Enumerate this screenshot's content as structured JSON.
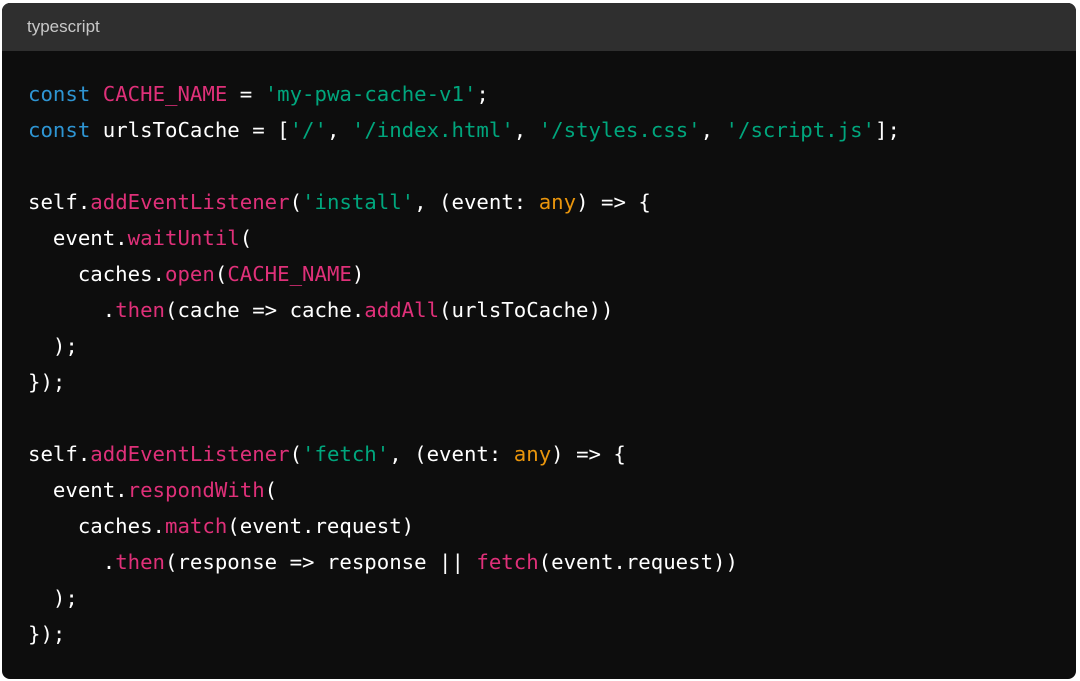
{
  "header": {
    "language": "typescript"
  },
  "colors": {
    "keyword": "#2e95d3",
    "identifier": "#df3079",
    "string": "#00a67d",
    "type": "#e9950c",
    "plain": "#ffffff",
    "background": "#0d0d0d",
    "header": "#2f2f2f"
  },
  "code": [
    [
      [
        "const",
        "kw"
      ],
      [
        " ",
        "pl"
      ],
      [
        "CACHE_NAME",
        "red"
      ],
      [
        " = ",
        "pl"
      ],
      [
        "'my-pwa-cache-v1'",
        "str"
      ],
      [
        ";",
        "pl"
      ]
    ],
    [
      [
        "const",
        "kw"
      ],
      [
        " urlsToCache = [",
        "pl"
      ],
      [
        "'/'",
        "str"
      ],
      [
        ", ",
        "pl"
      ],
      [
        "'/index.html'",
        "str"
      ],
      [
        ", ",
        "pl"
      ],
      [
        "'/styles.css'",
        "str"
      ],
      [
        ", ",
        "pl"
      ],
      [
        "'/script.js'",
        "str"
      ],
      [
        "];",
        "pl"
      ]
    ],
    [],
    [
      [
        "self.",
        "pl"
      ],
      [
        "addEventListener",
        "red"
      ],
      [
        "(",
        "pl"
      ],
      [
        "'install'",
        "str"
      ],
      [
        ", (event: ",
        "pl"
      ],
      [
        "any",
        "typ"
      ],
      [
        ") => {",
        "pl"
      ]
    ],
    [
      [
        "  event.",
        "pl"
      ],
      [
        "waitUntil",
        "red"
      ],
      [
        "(",
        "pl"
      ]
    ],
    [
      [
        "    caches.",
        "pl"
      ],
      [
        "open",
        "red"
      ],
      [
        "(",
        "pl"
      ],
      [
        "CACHE_NAME",
        "red"
      ],
      [
        ")",
        "pl"
      ]
    ],
    [
      [
        "      .",
        "pl"
      ],
      [
        "then",
        "red"
      ],
      [
        "(cache => cache.",
        "pl"
      ],
      [
        "addAll",
        "red"
      ],
      [
        "(urlsToCache))",
        "pl"
      ]
    ],
    [
      [
        "  );",
        "pl"
      ]
    ],
    [
      [
        "});",
        "pl"
      ]
    ],
    [],
    [
      [
        "self.",
        "pl"
      ],
      [
        "addEventListener",
        "red"
      ],
      [
        "(",
        "pl"
      ],
      [
        "'fetch'",
        "str"
      ],
      [
        ", (event: ",
        "pl"
      ],
      [
        "any",
        "typ"
      ],
      [
        ") => {",
        "pl"
      ]
    ],
    [
      [
        "  event.",
        "pl"
      ],
      [
        "respondWith",
        "red"
      ],
      [
        "(",
        "pl"
      ]
    ],
    [
      [
        "    caches.",
        "pl"
      ],
      [
        "match",
        "red"
      ],
      [
        "(event.request)",
        "pl"
      ]
    ],
    [
      [
        "      .",
        "pl"
      ],
      [
        "then",
        "red"
      ],
      [
        "(response => response || ",
        "pl"
      ],
      [
        "fetch",
        "red"
      ],
      [
        "(event.request))",
        "pl"
      ]
    ],
    [
      [
        "  );",
        "pl"
      ]
    ],
    [
      [
        "});",
        "pl"
      ]
    ]
  ]
}
